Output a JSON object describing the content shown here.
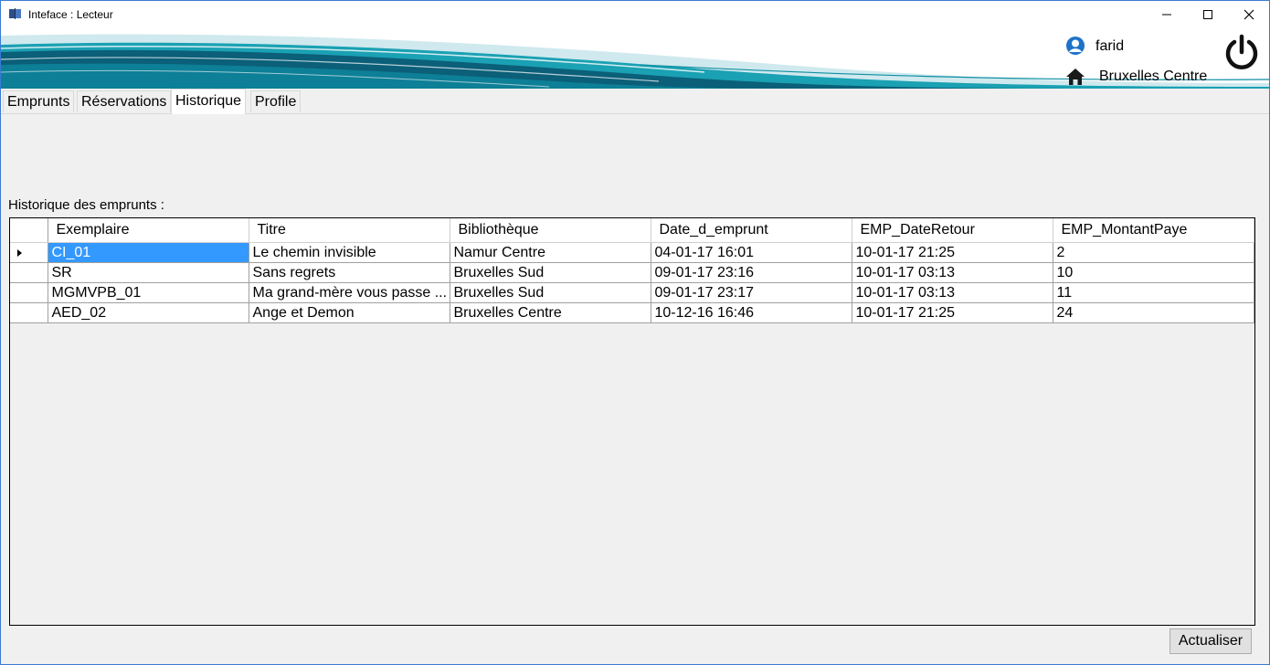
{
  "window": {
    "title": "Inteface : Lecteur",
    "controls": [
      "minimize",
      "maximize",
      "close"
    ]
  },
  "header": {
    "user_name": "farid",
    "branch": "Bruxelles Centre",
    "icons": [
      "user-icon",
      "home-icon",
      "power-icon"
    ]
  },
  "tabs": [
    {
      "label": "Emprunts",
      "active": false
    },
    {
      "label": "Réservations",
      "active": false
    },
    {
      "label": "Historique",
      "active": true
    },
    {
      "label": "Profile",
      "active": false
    }
  ],
  "history": {
    "label": "Historique des emprunts :",
    "columns": [
      "Exemplaire",
      "Titre",
      "Bibliothèque",
      "Date_d_emprunt",
      "EMP_DateRetour",
      "EMP_MontantPaye"
    ],
    "rows": [
      [
        "CI_01",
        "Le chemin invisible",
        "Namur Centre",
        "04-01-17 16:01",
        "10-01-17 21:25",
        "2"
      ],
      [
        "SR",
        "Sans regrets",
        "Bruxelles Sud",
        "09-01-17 23:16",
        "10-01-17 03:13",
        "10"
      ],
      [
        "MGMVPB_01",
        "Ma grand-mère vous passe ...",
        "Bruxelles Sud",
        "09-01-17 23:17",
        "10-01-17 03:13",
        "11"
      ],
      [
        "AED_02",
        "Ange et Demon",
        "Bruxelles Centre",
        "10-12-16 16:46",
        "10-01-17 21:25",
        "24"
      ]
    ],
    "selected_row": 0
  },
  "actions": {
    "refresh_label": "Actualiser"
  },
  "colors": {
    "selection": "#3399ff",
    "banner_teal": "#0f8fa3",
    "banner_dark": "#0b4f66"
  }
}
